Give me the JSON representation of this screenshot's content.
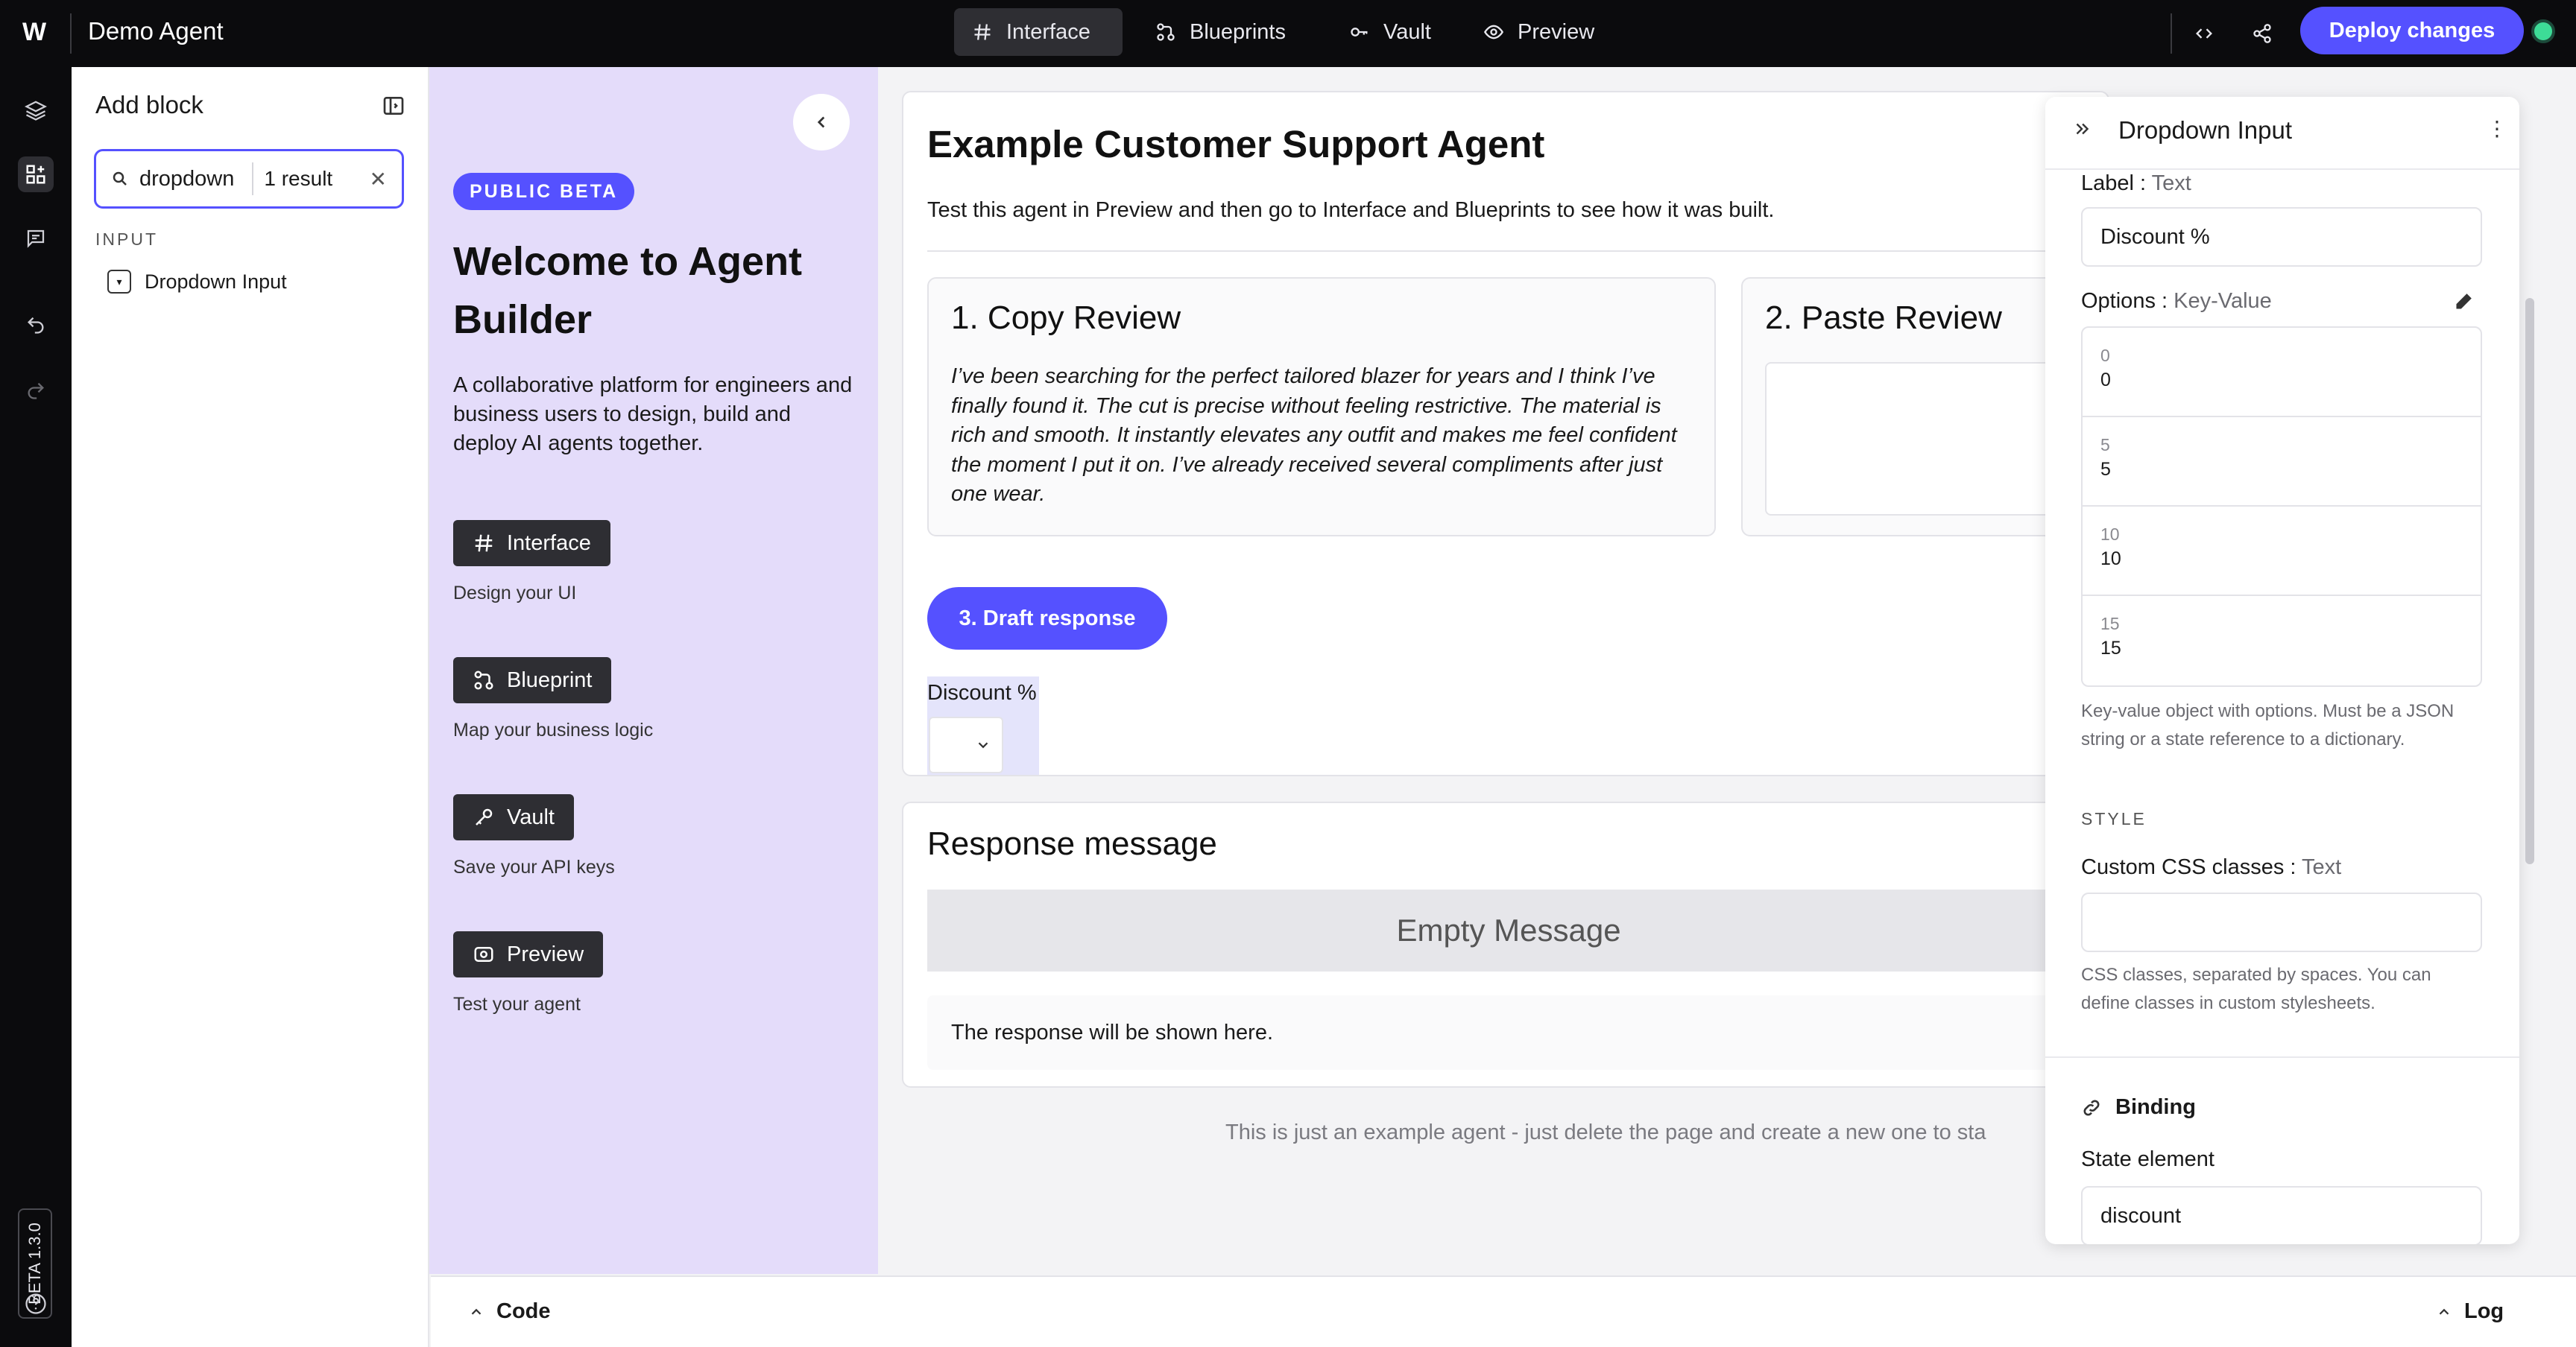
{
  "topbar": {
    "logo": "W",
    "app_title": "Demo Agent",
    "tabs": [
      {
        "label": "Interface",
        "icon": "hash-icon",
        "active": true
      },
      {
        "label": "Blueprints",
        "icon": "blueprint-icon",
        "active": false
      },
      {
        "label": "Vault",
        "icon": "key-icon",
        "active": false
      },
      {
        "label": "Preview",
        "icon": "eye-icon",
        "active": false
      }
    ],
    "deploy_label": "Deploy changes",
    "status_color": "#3ddc97"
  },
  "rail": {
    "items": [
      "layers-icon",
      "add-block-icon",
      "comment-icon",
      "undo-icon",
      "redo-icon"
    ],
    "beta_label": "BETA 1.3.0",
    "help_icon": "help-icon"
  },
  "add_block": {
    "title": "Add block",
    "search_value": "dropdown",
    "result_count": "1 result",
    "section": "INPUT",
    "items": [
      {
        "label": "Dropdown Input"
      }
    ]
  },
  "welcome": {
    "badge": "PUBLIC BETA",
    "title": "Welcome to Agent Builder",
    "description": "A collaborative platform for engineers and business users to design, build and deploy AI agents together.",
    "buttons": [
      {
        "label": "Interface",
        "caption": "Design your UI"
      },
      {
        "label": "Blueprint",
        "caption": "Map your business logic"
      },
      {
        "label": "Vault",
        "caption": "Save your API keys"
      },
      {
        "label": "Preview",
        "caption": "Test your agent"
      }
    ]
  },
  "canvas": {
    "title": "Example Customer Support Agent",
    "subtitle": "Test this agent in Preview and then go to Interface and Blueprints to see how it was built.",
    "copy_review": {
      "title": "1. Copy Review",
      "text": "I’ve been searching for the perfect tailored blazer for years and I think I’ve finally found it. The cut is precise without feeling restrictive. The material is rich and smooth. It instantly elevates any outfit and makes me feel confident the moment I put it on. I’ve already received several compliments after just one wear."
    },
    "paste_review": {
      "title": "2. Paste Review"
    },
    "draft_button": "3. Draft response",
    "dropdown_label": "Discount %",
    "response": {
      "title": "Response message",
      "empty": "Empty Message",
      "placeholder": "The response will be shown here."
    },
    "footer_note": "This is just an example agent - just delete the page and create a new one to sta"
  },
  "props": {
    "title": "Dropdown Input",
    "label_field": {
      "name": "Label",
      "type": "Text",
      "value": "Discount %"
    },
    "options_field": {
      "name": "Options",
      "type": "Key-Value",
      "rows": [
        {
          "key": "0",
          "value": "0"
        },
        {
          "key": "5",
          "value": "5"
        },
        {
          "key": "10",
          "value": "10"
        },
        {
          "key": "15",
          "value": "15"
        }
      ],
      "help": "Key-value object with options. Must be a JSON string or a state reference to a dictionary."
    },
    "style_heading": "STYLE",
    "css_field": {
      "name": "Custom CSS classes",
      "type": "Text",
      "value": "",
      "help": "CSS classes, separated by spaces. You can define classes in custom stylesheets."
    },
    "binding": {
      "title": "Binding",
      "state_label": "State element",
      "state_value": "discount"
    }
  },
  "bottombar": {
    "code_label": "Code",
    "log_label": "Log"
  }
}
